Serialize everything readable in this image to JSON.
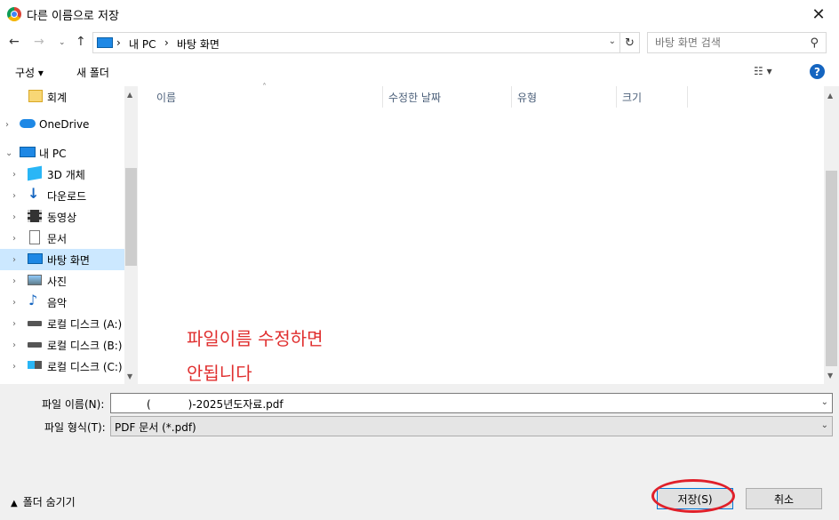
{
  "window": {
    "title": "다른 이름으로 저장",
    "close": "✕"
  },
  "address": {
    "crumbs": [
      "내 PC",
      "바탕 화면"
    ],
    "search_placeholder": "바탕 화면 검색"
  },
  "toolbar": {
    "organize": "구성 ▾",
    "new_folder": "새 폴더",
    "view": "☷ ▾",
    "help": "?"
  },
  "navpane": {
    "items": [
      {
        "label": "회계",
        "icon": "folder-icon",
        "caret": ""
      },
      {
        "label": "OneDrive",
        "icon": "cloud-icon",
        "caret": "›"
      },
      {
        "label": "내 PC",
        "icon": "pc-icon",
        "caret": "⌄"
      },
      {
        "label": "3D 개체",
        "icon": "cube-icon",
        "caret": "›"
      },
      {
        "label": "다운로드",
        "icon": "download-icon",
        "caret": "›"
      },
      {
        "label": "동영상",
        "icon": "video-icon",
        "caret": "›"
      },
      {
        "label": "문서",
        "icon": "document-icon",
        "caret": "›"
      },
      {
        "label": "바탕 화면",
        "icon": "desktop-icon",
        "caret": "›"
      },
      {
        "label": "사진",
        "icon": "picture-icon",
        "caret": "›"
      },
      {
        "label": "음악",
        "icon": "music-icon",
        "caret": "›"
      },
      {
        "label": "로컬 디스크 (A:)",
        "icon": "drive-icon",
        "caret": "›"
      },
      {
        "label": "로컬 디스크 (B:)",
        "icon": "drive-icon",
        "caret": "›"
      },
      {
        "label": "로컬 디스크 (C:)",
        "icon": "windows-drive-icon",
        "caret": "›"
      }
    ]
  },
  "columns": [
    "이름",
    "수정한 날짜",
    "유형",
    "크기"
  ],
  "annotation": {
    "line1": "파일이름 수정하면",
    "line2": "안됩니다"
  },
  "bottom": {
    "filename_label": "파일 이름(N):",
    "filename_value": "(           )-2025년도자료.pdf",
    "filetype_label": "파일 형식(T):",
    "filetype_value": "PDF 문서 (*.pdf)",
    "hide_folders": "폴더 숨기기",
    "save": "저장(S)",
    "cancel": "취소"
  },
  "colors": {
    "annotation_red": "#e03030",
    "selected_bg": "#cce8ff",
    "help_blue": "#1565c0"
  }
}
